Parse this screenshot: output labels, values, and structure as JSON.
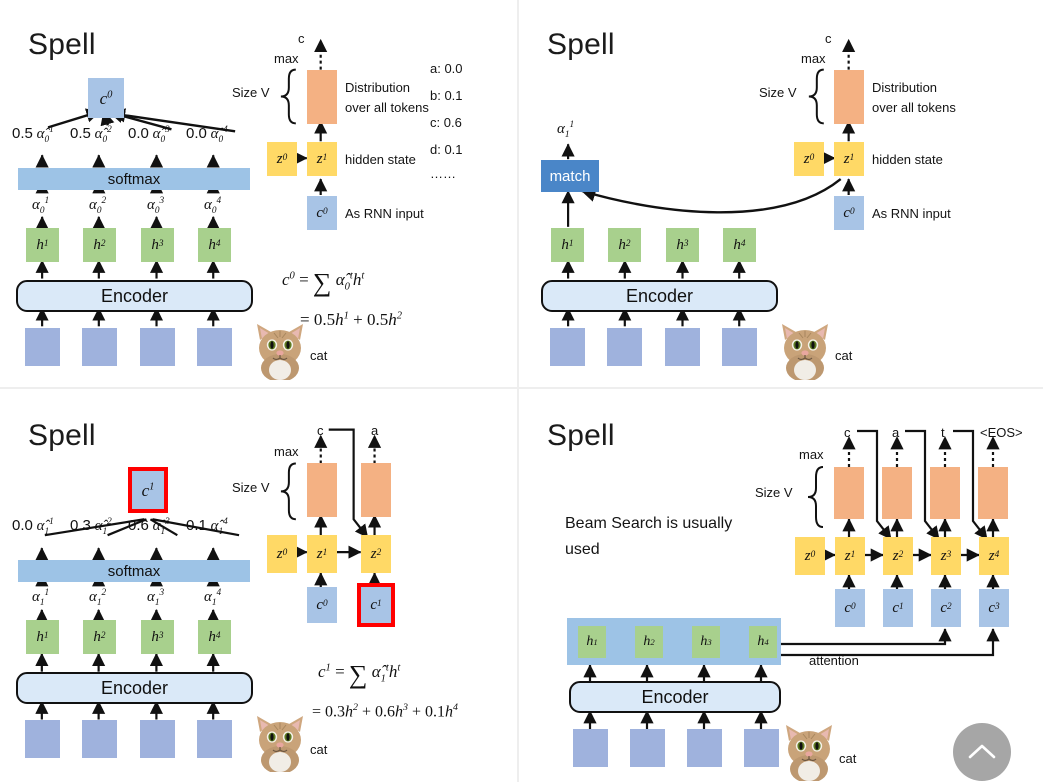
{
  "document": {
    "kind": "slide-grid",
    "columns": 2,
    "rows": 2
  },
  "colors": {
    "input_block": "#9fb2dd",
    "context_block": "#a8c4e6",
    "hidden_h": "#a8d08d",
    "hidden_z": "#ffd966",
    "distribution": "#f4b183",
    "softmax_bar": "#9dc3e6",
    "encoder_fill": "#dae9f8",
    "match_fill": "#4a86c8",
    "highlight": "#ff0000",
    "scroll_button": "#a6a6a6",
    "divider": "#eeeeee",
    "page_background": "#f2f2f2"
  },
  "slides": [
    {
      "id": "slide-1",
      "title": "Spell",
      "attention_weights_label": "softmax",
      "context_label": "c",
      "context_sup": "0",
      "weights": [
        {
          "value": "0.5",
          "sym": "α̂",
          "sup": "1",
          "sub": "0"
        },
        {
          "value": "0.5",
          "sym": "α̂",
          "sup": "2",
          "sub": "0"
        },
        {
          "value": "0.0",
          "sym": "α̂",
          "sup": "3",
          "sub": "0"
        },
        {
          "value": "0.0",
          "sym": "α̂",
          "sup": "4",
          "sub": "0"
        }
      ],
      "raw_weights": [
        {
          "sym": "α",
          "sup": "1",
          "sub": "0"
        },
        {
          "sym": "α",
          "sup": "2",
          "sub": "0"
        },
        {
          "sym": "α",
          "sup": "3",
          "sub": "0"
        },
        {
          "sym": "α",
          "sup": "4",
          "sub": "0"
        }
      ],
      "hidden_states": [
        "h¹",
        "h²",
        "h³",
        "h⁴"
      ],
      "encoder_label": "Encoder",
      "image_caption": "cat",
      "decoder": {
        "max_label": "max",
        "output_token": "c",
        "size_label": "Size V",
        "distribution_text_line1": "Distribution",
        "distribution_text_line2": "over all tokens",
        "hidden_state_label": "hidden state",
        "rnn_input_label": "As RNN input",
        "z_states": [
          "z⁰",
          "z¹"
        ],
        "context_input": "c⁰"
      },
      "token_probs": [
        "a: 0.0",
        "b: 0.1",
        "c: 0.6",
        "d: 0.1",
        "……"
      ],
      "formula_line1": "c⁰ = ∑ α̂₀ᵗhᵗ",
      "formula_line2": "= 0.5h¹ + 0.5h²"
    },
    {
      "id": "slide-2",
      "title": "Spell",
      "match_label": "match",
      "match_output": {
        "sym": "α",
        "sup": "1",
        "sub": "1"
      },
      "hidden_states": [
        "h¹",
        "h²",
        "h³",
        "h⁴"
      ],
      "encoder_label": "Encoder",
      "image_caption": "cat",
      "decoder": {
        "max_label": "max",
        "output_token": "c",
        "size_label": "Size V",
        "distribution_text_line1": "Distribution",
        "distribution_text_line2": "over all tokens",
        "hidden_state_label": "hidden state",
        "rnn_input_label": "As RNN input",
        "z_states": [
          "z⁰",
          "z¹"
        ],
        "context_input": "c⁰"
      }
    },
    {
      "id": "slide-3",
      "title": "Spell",
      "attention_weights_label": "softmax",
      "context_label": "c",
      "context_sup": "1",
      "context_highlighted": true,
      "weights": [
        {
          "value": "0.0",
          "sym": "α̂",
          "sup": "1",
          "sub": "1"
        },
        {
          "value": "0.3",
          "sym": "α̂",
          "sup": "2",
          "sub": "1"
        },
        {
          "value": "0.6",
          "sym": "α̂",
          "sup": "3",
          "sub": "1"
        },
        {
          "value": "0.1",
          "sym": "α̂",
          "sup": "4",
          "sub": "1"
        }
      ],
      "raw_weights": [
        {
          "sym": "α",
          "sup": "1",
          "sub": "1"
        },
        {
          "sym": "α",
          "sup": "2",
          "sub": "1"
        },
        {
          "sym": "α",
          "sup": "3",
          "sub": "1"
        },
        {
          "sym": "α",
          "sup": "4",
          "sub": "1"
        }
      ],
      "hidden_states": [
        "h¹",
        "h²",
        "h³",
        "h⁴"
      ],
      "encoder_label": "Encoder",
      "image_caption": "cat",
      "decoder": {
        "max_label": "max",
        "size_label": "Size V",
        "output_tokens": [
          "c",
          "a"
        ],
        "z_states": [
          "z⁰",
          "z¹",
          "z²"
        ],
        "context_inputs": [
          "c⁰",
          "c¹"
        ],
        "highlighted_context": "c¹"
      },
      "formula_line1": "c¹ = ∑ α̂₁ᵗhᵗ",
      "formula_line2": "= 0.3h² + 0.6h³ + 0.1h⁴"
    },
    {
      "id": "slide-4",
      "title": "Spell",
      "note_line1": "Beam Search is usually",
      "note_line2": "used",
      "hidden_states": [
        "h¹",
        "h²",
        "h³",
        "h⁴"
      ],
      "encoder_label": "Encoder",
      "image_caption": "cat",
      "attention_label": "attention",
      "decoder": {
        "max_label": "max",
        "size_label": "Size V",
        "output_tokens": [
          "c",
          "a",
          "t",
          "<EOS>"
        ],
        "z_states": [
          "z⁰",
          "z¹",
          "z²",
          "z³",
          "z⁴"
        ],
        "context_inputs": [
          "c⁰",
          "c¹",
          "c²",
          "c³"
        ]
      },
      "scroll_top_button": "scroll-to-top"
    }
  ]
}
